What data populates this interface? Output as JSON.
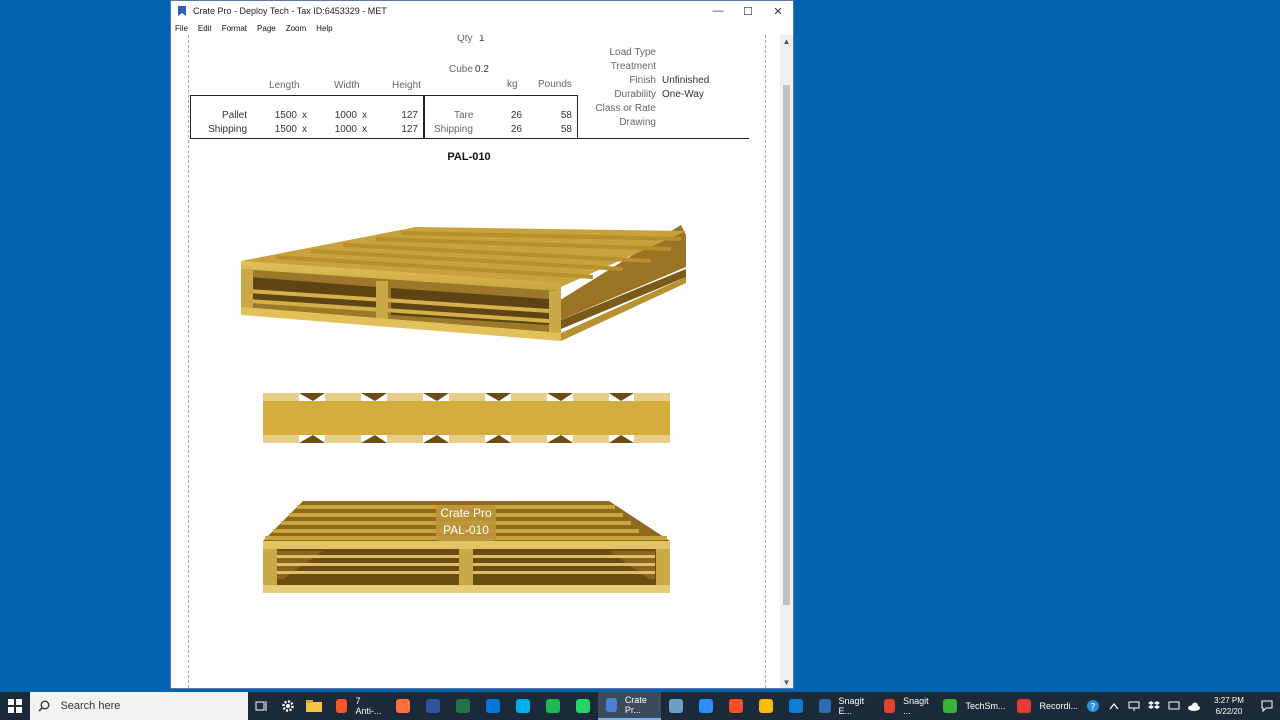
{
  "window": {
    "title": "Crate Pro - Deploy Tech - Tax ID:6453329 - MET",
    "controls": {
      "minimize": "—",
      "maximize": "☐",
      "close": "✕"
    }
  },
  "menu": [
    "File",
    "Edit",
    "Format",
    "Page",
    "Zoom",
    "Help"
  ],
  "report": {
    "qty_label": "Qty",
    "qty_value": "1",
    "cube_label": "Cube",
    "cube_value": "0.2",
    "headers": {
      "length": "Length",
      "width": "Width",
      "height": "Height",
      "kg": "kg",
      "pounds": "Pounds"
    },
    "rows": [
      {
        "label": "Pallet",
        "length": "1500",
        "x1": "x",
        "width": "1000",
        "x2": "x",
        "height": "127",
        "weight_label": "Tare",
        "kg": "26",
        "pounds": "58"
      },
      {
        "label": "Shipping",
        "length": "1500",
        "x1": "x",
        "width": "1000",
        "x2": "x",
        "height": "127",
        "weight_label": "Shipping",
        "kg": "26",
        "pounds": "58"
      }
    ],
    "properties": [
      {
        "label": "Load Type",
        "value": ""
      },
      {
        "label": "Treatment",
        "value": ""
      },
      {
        "label": "Finish",
        "value": "Unfinished"
      },
      {
        "label": "Durability",
        "value": "One-Way"
      },
      {
        "label": "Class or Rate",
        "value": ""
      },
      {
        "label": "Drawing",
        "value": ""
      }
    ],
    "part_number": "PAL-010",
    "watermark": [
      "Crate Pro",
      "PAL-010"
    ]
  },
  "taskbar": {
    "search_placeholder": "Search here",
    "apps": [
      {
        "icon": "brave-icon",
        "label": "7 Anti-...",
        "color": "#fb542b"
      },
      {
        "icon": "firefox-icon",
        "label": "",
        "color": "#ff7139"
      },
      {
        "icon": "word-icon",
        "label": "",
        "color": "#2b579a"
      },
      {
        "icon": "excel-icon",
        "label": "",
        "color": "#217346"
      },
      {
        "icon": "store-icon",
        "label": "",
        "color": "#0078d7"
      },
      {
        "icon": "skype-icon",
        "label": "",
        "color": "#00aff0"
      },
      {
        "icon": "spotify-icon",
        "label": "",
        "color": "#1db954"
      },
      {
        "icon": "whatsapp-icon",
        "label": "",
        "color": "#25d366"
      },
      {
        "icon": "cratepro-icon",
        "label": "Crate Pr...",
        "color": "#4a7fd6",
        "active": true
      },
      {
        "icon": "globe-icon",
        "label": "",
        "color": "#6aa0c8"
      },
      {
        "icon": "zoom-icon",
        "label": "",
        "color": "#2d8cff"
      },
      {
        "icon": "office-icon",
        "label": "",
        "color": "#f25022"
      },
      {
        "icon": "chrome-icon",
        "label": "",
        "color": "#fbbc05"
      },
      {
        "icon": "edge-icon",
        "label": "",
        "color": "#0c7dd6"
      },
      {
        "icon": "snagit-editor-icon",
        "label": "Snagit E...",
        "color": "#2d6db5"
      },
      {
        "icon": "snagit-icon",
        "label": "Snagit ...",
        "color": "#e4412b"
      },
      {
        "icon": "techsmith-icon",
        "label": "TechSm...",
        "color": "#3bb33b"
      },
      {
        "icon": "recorder-icon",
        "label": "Recordi...",
        "color": "#e53935"
      }
    ],
    "clock_time": "3:27 PM",
    "clock_date": "6/22/20"
  }
}
